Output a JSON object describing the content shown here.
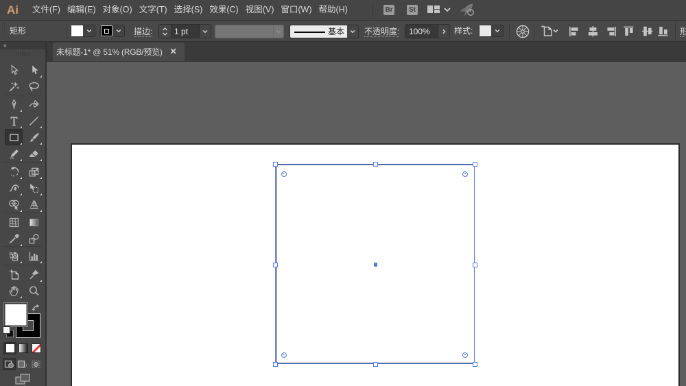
{
  "app": "Adobe Illustrator",
  "colors": {
    "menubar_bg": "#454545",
    "controlbar_bg": "#484848",
    "tabbar_bg": "#3a3a3a",
    "tab_active_bg": "#4a4a4a",
    "panel_bg": "#474747",
    "pasteboard": "#5e5e5e",
    "artboard": "#ffffff",
    "selection_blue": "#4f7cf0",
    "logo_orange": "#d89b6a",
    "icon_gray": "#b9b9b9",
    "none_red": "#e03a3a"
  },
  "menubar": {
    "logo": "Ai",
    "items": [
      {
        "label": "文件(F)"
      },
      {
        "label": "编辑(E)"
      },
      {
        "label": "对象(O)"
      },
      {
        "label": "文字(T)"
      },
      {
        "label": "选择(S)"
      },
      {
        "label": "效果(C)"
      },
      {
        "label": "视图(V)"
      },
      {
        "label": "窗口(W)"
      },
      {
        "label": "帮助(H)"
      }
    ],
    "bridge_button": "Br",
    "stock_button": "St",
    "workspace_switcher_icon": "workspace-layout-icon",
    "gpu_performance_icon": "rocket-power-icon"
  },
  "controlbar": {
    "context_label": "矩形",
    "fill_swatch": "#ffffff",
    "stroke_swatch": "#000000",
    "stroke_label": "描边:",
    "stroke_weight": "1 pt",
    "brush_definition": "基本",
    "opacity_label": "不透明度:",
    "opacity_value": "100%",
    "style_label": "样式:",
    "recolor_icon": "color-wheel-icon",
    "align_to_icon": "align-to-artboard-icon",
    "align_items": [
      {
        "name": "horizontal-align-left"
      },
      {
        "name": "horizontal-align-center"
      },
      {
        "name": "horizontal-align-right"
      },
      {
        "name": "vertical-align-top"
      },
      {
        "name": "vertical-align-center"
      },
      {
        "name": "vertical-align-bottom"
      }
    ],
    "shape_label_partial": "形"
  },
  "tabbar": {
    "tab_title": "未标题-1* @ 51% (RGB/预览)",
    "close": "×",
    "collapse_icon": "««"
  },
  "tools": {
    "rows": [
      {
        "left": {
          "name": "selection-tool",
          "fly": false
        },
        "right": {
          "name": "direct-selection-tool",
          "fly": true
        }
      },
      {
        "left": {
          "name": "magic-wand-tool",
          "fly": false
        },
        "right": {
          "name": "lasso-tool",
          "fly": false
        }
      },
      {
        "left": {
          "name": "pen-tool",
          "fly": true
        },
        "right": {
          "name": "curvature-tool",
          "fly": false
        }
      },
      {
        "left": {
          "name": "type-tool",
          "fly": true
        },
        "right": {
          "name": "line-segment-tool",
          "fly": true
        }
      },
      {
        "left": {
          "name": "rectangle-tool",
          "fly": true,
          "selected": true
        },
        "right": {
          "name": "paintbrush-tool",
          "fly": true
        }
      },
      {
        "left": {
          "name": "shaper-tool",
          "fly": true
        },
        "right": {
          "name": "eraser-tool",
          "fly": true
        }
      },
      {
        "left": {
          "name": "rotate-tool",
          "fly": true
        },
        "right": {
          "name": "scale-tool",
          "fly": true
        }
      },
      {
        "left": {
          "name": "width-tool",
          "fly": true
        },
        "right": {
          "name": "free-transform-tool",
          "fly": true
        }
      },
      {
        "left": {
          "name": "shape-builder-tool",
          "fly": true
        },
        "right": {
          "name": "perspective-grid-tool",
          "fly": true
        }
      },
      {
        "left": {
          "name": "mesh-tool",
          "fly": false
        },
        "right": {
          "name": "gradient-tool",
          "fly": false
        }
      },
      {
        "left": {
          "name": "eyedropper-tool",
          "fly": true
        },
        "right": {
          "name": "blend-tool",
          "fly": false
        }
      },
      {
        "left": {
          "name": "symbol-sprayer-tool",
          "fly": true
        },
        "right": {
          "name": "column-graph-tool",
          "fly": true
        }
      },
      {
        "left": {
          "name": "artboard-tool",
          "fly": false
        },
        "right": {
          "name": "slice-tool",
          "fly": true
        }
      },
      {
        "left": {
          "name": "hand-tool",
          "fly": true
        },
        "right": {
          "name": "zoom-tool",
          "fly": false
        }
      }
    ],
    "separators_after_rows": [
      2,
      6,
      9,
      11,
      12
    ],
    "fill_color": "#ffffff",
    "stroke_color": "#000000",
    "color_mode_buttons": [
      "color",
      "gradient",
      "none"
    ],
    "drawing_mode_buttons": [
      "draw-normal",
      "draw-behind",
      "draw-inside"
    ],
    "screen_mode_button": "change-screen-mode"
  },
  "canvas": {
    "selection": {
      "shape": "rectangle",
      "handles": 8,
      "corner_widgets": 4,
      "center_point": true
    }
  }
}
